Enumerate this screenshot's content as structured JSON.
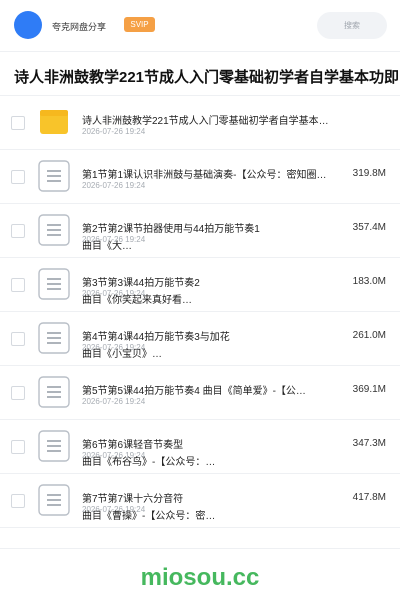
{
  "header": {
    "owner": "夸克网盘分享",
    "vip_badge": "SVIP",
    "search_placeholder": "搜索"
  },
  "title": "诗人非洲鼓教学221节成人入门零基础初学者自学基本功即",
  "items": [
    {
      "type": "folder",
      "name": "诗人非洲鼓教学221节成人入门零基础初学者自学基本…",
      "name2": "",
      "date": "2026-07-26 19:24",
      "size": ""
    },
    {
      "type": "file",
      "name": "第1节第1课认识非洲鼓与基础演奏-【公众号：密知圈…",
      "name2": "",
      "date": "2026-07-26 19:24",
      "size": "319.8M"
    },
    {
      "type": "file",
      "name": "第2节第2课节拍器使用与44拍万能节奏1",
      "name2": "曲目《大…",
      "date": "2026-07-26 19:24",
      "size": "357.4M"
    },
    {
      "type": "file",
      "name": "第3节第3课44拍万能节奏2",
      "name2": "曲目《你笑起来真好看…",
      "date": "2026-07-26 19:24",
      "size": "183.0M"
    },
    {
      "type": "file",
      "name": "第4节第4课44拍万能节奏3与加花",
      "name2": "曲目《小宝贝》…",
      "date": "2026-07-26 19:24",
      "size": "261.0M"
    },
    {
      "type": "file",
      "name": "第5节第5课44拍万能节奏4 曲目《简单爱》-【公…",
      "name2": "",
      "date": "2026-07-26 19:24",
      "size": "369.1M"
    },
    {
      "type": "file",
      "name": "第6节第6课轻音节奏型",
      "name2": "曲目《布谷鸟》-【公众号：…",
      "date": "2026-07-26 19:24",
      "size": "347.3M"
    },
    {
      "type": "file",
      "name": "第7节第7课十六分音符",
      "name2": "曲目《曹操》-【公众号：密…",
      "date": "2026-07-26 19:24",
      "size": "417.8M"
    }
  ],
  "watermark": "miosou.cc",
  "colors": {
    "accent": "#2f7cf6",
    "vip": "#f5a045",
    "watermark": "#46b85e",
    "folder": "#f8c42a"
  }
}
